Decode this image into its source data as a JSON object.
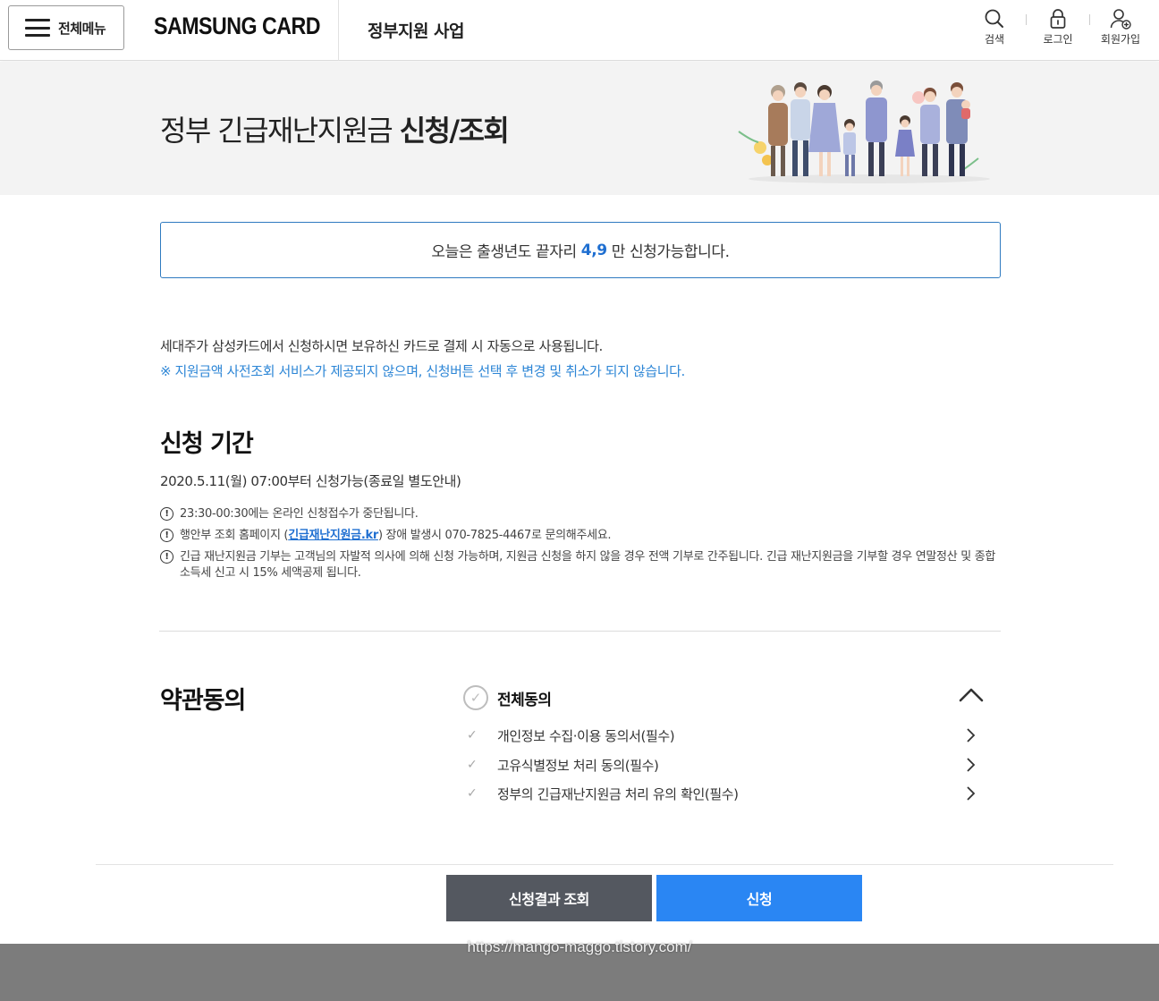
{
  "header": {
    "menu_label": "전체메뉴",
    "logo": "SAMSUNG CARD",
    "title": "정부지원 사업",
    "utils": [
      {
        "label": "검색",
        "icon": "search-icon"
      },
      {
        "label": "로그인",
        "icon": "lock-icon"
      },
      {
        "label": "회원가입",
        "icon": "add-user-icon"
      }
    ]
  },
  "banner": {
    "title_regular": "정부 긴급재난지원금",
    "title_bold": "신청/조회"
  },
  "notice": {
    "prefix": "오늘은 출생년도 끝자리",
    "digits": "4,9",
    "suffix": "만 신청가능합니다."
  },
  "description": {
    "line1": "세대주가 삼성카드에서 신청하시면 보유하신 카드로 결제 시 자동으로 사용됩니다.",
    "line2": "※ 지원금액 사전조회 서비스가 제공되지 않으며, 신청버튼 선택 후 변경 및 취소가 되지 않습니다."
  },
  "period": {
    "title": "신청 기간",
    "text": "2020.5.11(월) 07:00부터 신청가능(종료일 별도안내)",
    "notes": [
      {
        "text": "23:30-00:30에는 온라인 신청접수가 중단됩니다."
      },
      {
        "before": "행안부 조회 홈페이지 (",
        "link": "긴급재난지원금.kr",
        "after": ") 장애 발생시 070-7825-4467로 문의해주세요."
      },
      {
        "text": "긴급 재난지원금 기부는 고객님의 자발적 의사에 의해 신청 가능하며, 지원금 신청을 하지 않을 경우 전액 기부로 간주됩니다. 긴급 재난지원금을 기부할 경우 연말정산 및 종합소득세 신고 시 15% 세액공제 됩니다."
      }
    ],
    "note_icon": "!"
  },
  "terms": {
    "title": "약관동의",
    "all_label": "전체동의",
    "items": [
      {
        "label": "개인정보 수집·이용 동의서(필수)"
      },
      {
        "label": "고유식별정보 처리 동의(필수)"
      },
      {
        "label": "정부의 긴급재난지원금 처리 유의 확인(필수)"
      }
    ],
    "check_glyph": "✓"
  },
  "buttons": {
    "result": "신청결과 조회",
    "apply": "신청"
  },
  "watermark": "https://mango-maggo.tistory.com/",
  "colors": {
    "accent_blue": "#2a86f3",
    "link_blue": "#1f6fd1",
    "notice_border": "#2f7ac0",
    "dark_button": "#545860"
  }
}
